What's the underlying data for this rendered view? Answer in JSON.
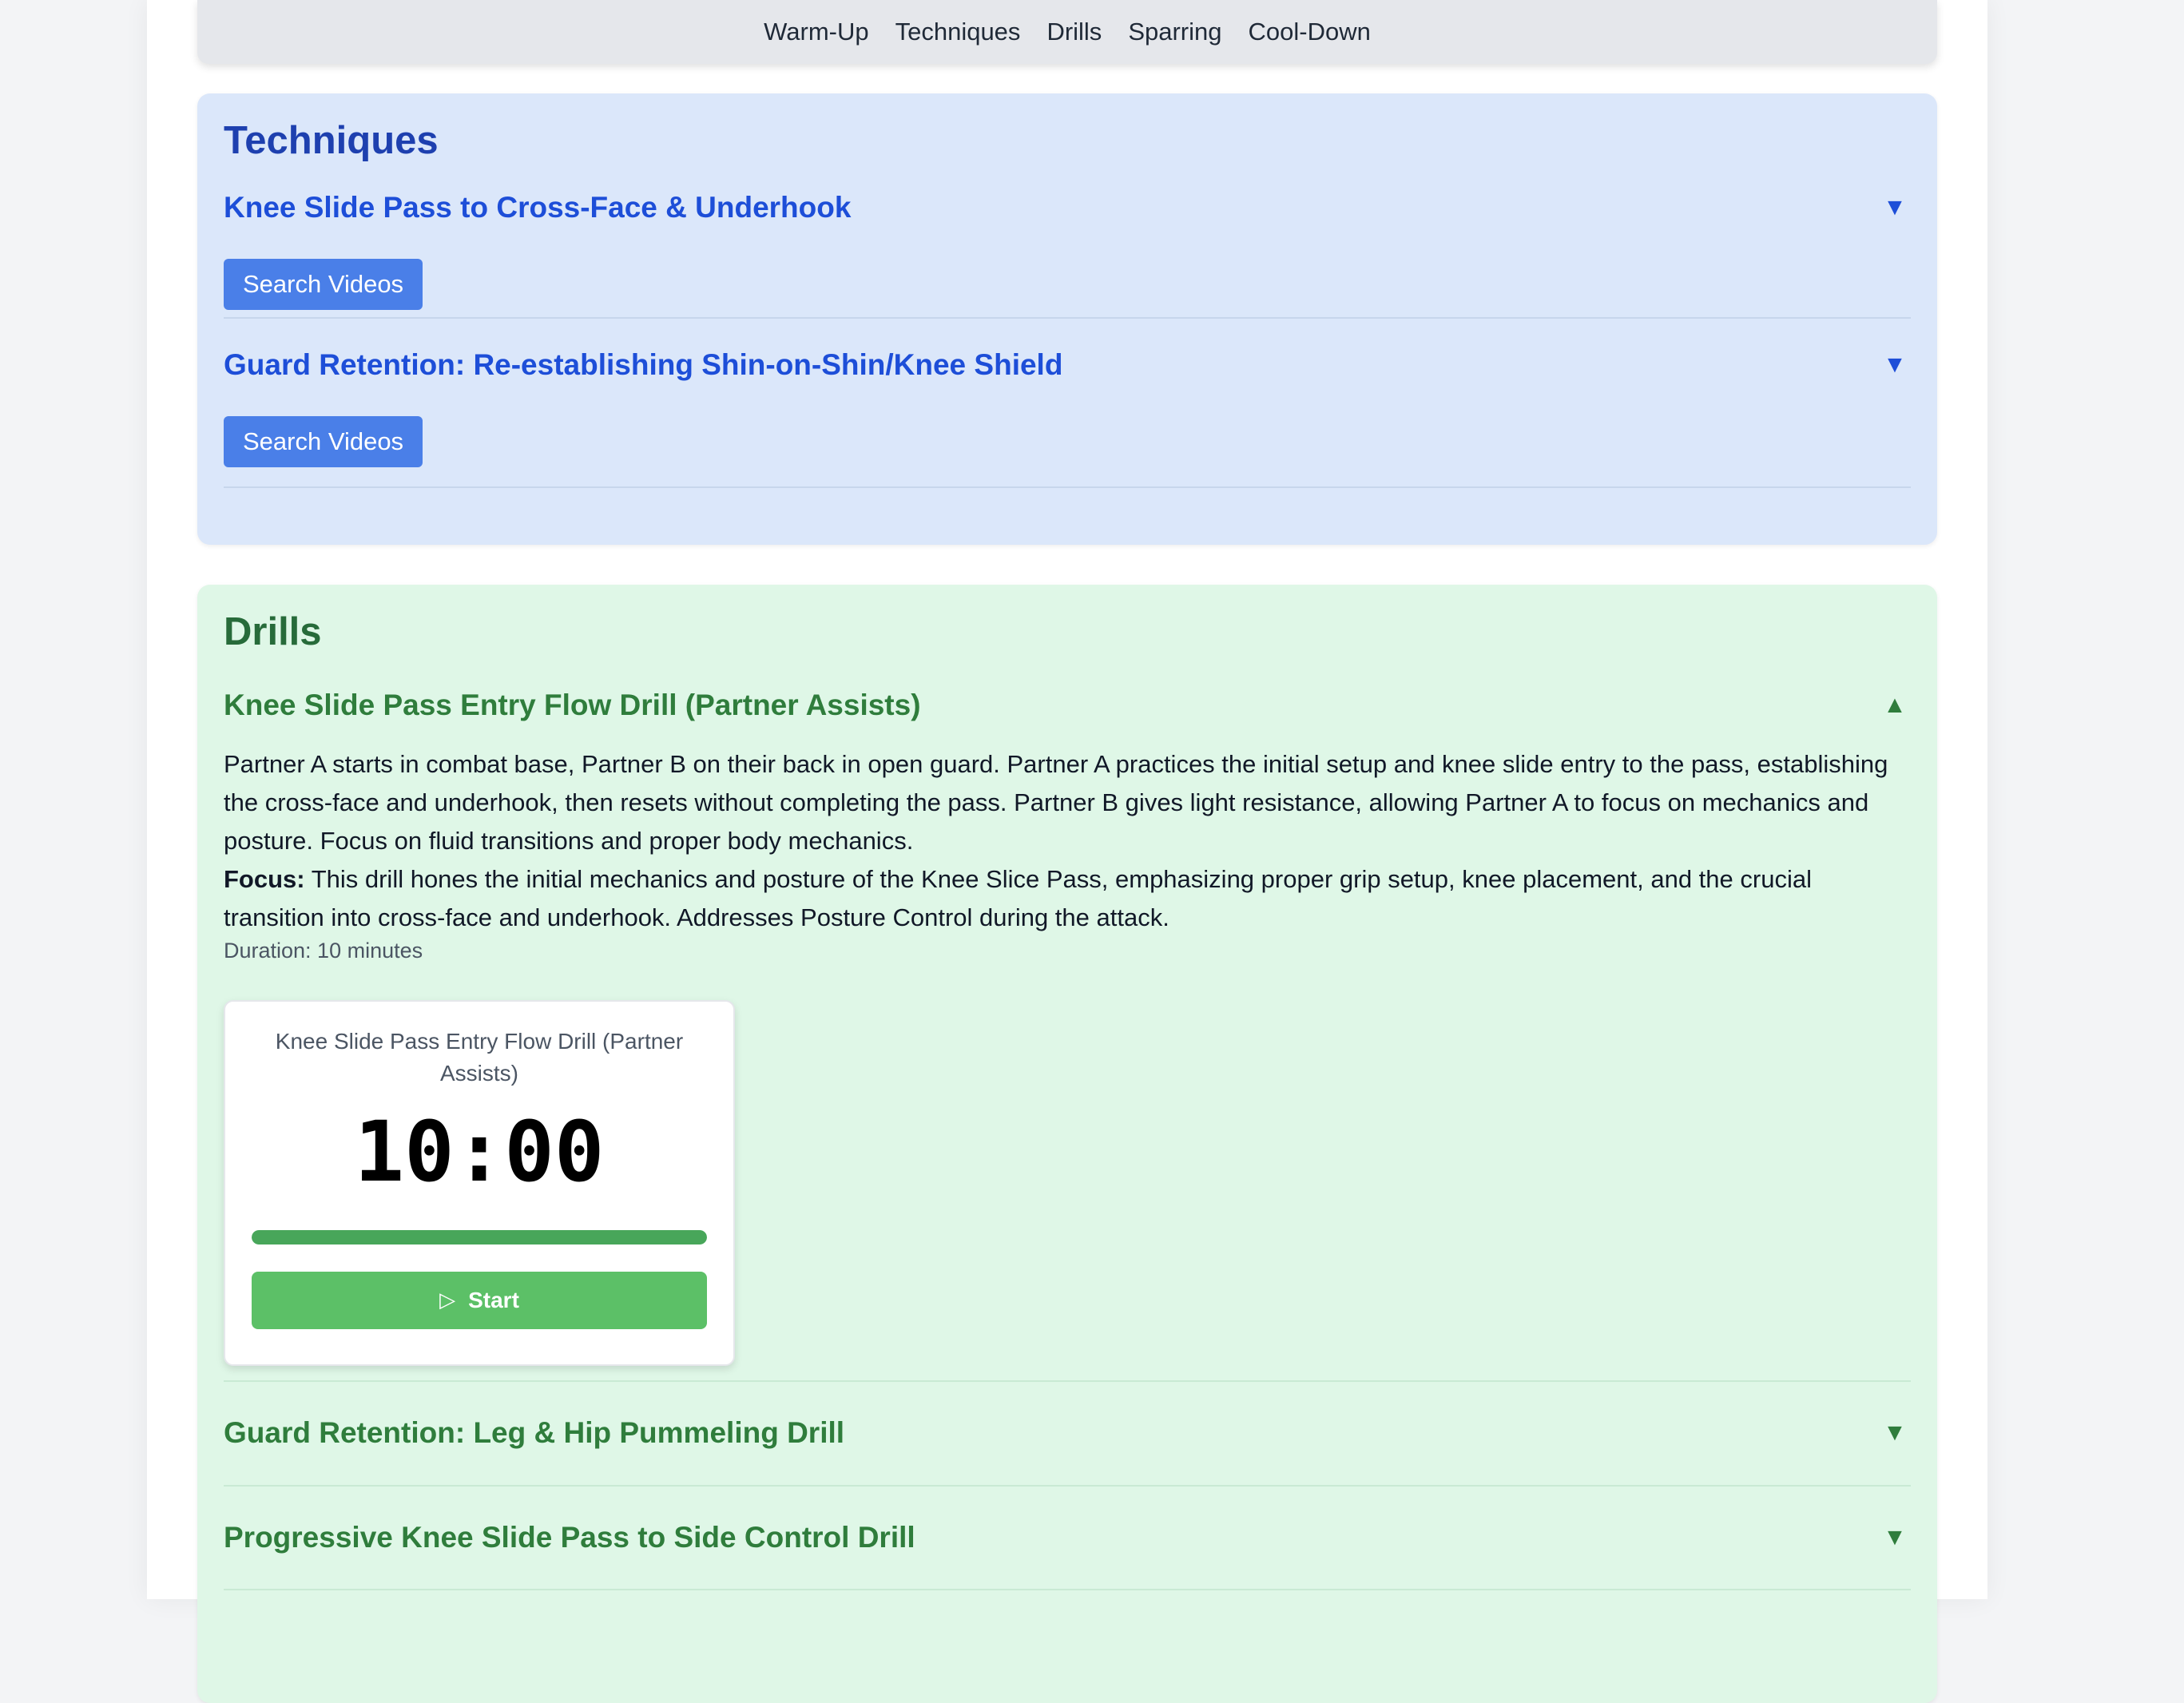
{
  "nav": {
    "items": [
      "Warm-Up",
      "Techniques",
      "Drills",
      "Sparring",
      "Cool-Down"
    ]
  },
  "techniques": {
    "title": "Techniques",
    "items": [
      {
        "title": "Knee Slide Pass to Cross-Face & Underhook",
        "button": "Search Videos",
        "chevron": "▼"
      },
      {
        "title": "Guard Retention: Re-establishing Shin-on-Shin/Knee Shield",
        "button": "Search Videos",
        "chevron": "▼"
      }
    ]
  },
  "drills": {
    "title": "Drills",
    "items": [
      {
        "title": "Knee Slide Pass Entry Flow Drill (Partner Assists)",
        "chevron": "▲",
        "description": "Partner A starts in combat base, Partner B on their back in open guard. Partner A practices the initial setup and knee slide entry to the pass, establishing the cross-face and underhook, then resets without completing the pass. Partner B gives light resistance, allowing Partner A to focus on mechanics and posture. Focus on fluid transitions and proper body mechanics.",
        "focus_label": "Focus:",
        "focus_text": "This drill hones the initial mechanics and posture of the Knee Slice Pass, emphasizing proper grip setup, knee placement, and the crucial transition into cross-face and underhook. Addresses Posture Control during the attack.",
        "duration": "Duration: 10 minutes",
        "timer": {
          "title": "Knee Slide Pass Entry Flow Drill (Partner Assists)",
          "value": "10:00",
          "progress": 1.0,
          "start_label": "Start",
          "start_icon": "play-icon"
        }
      },
      {
        "title": "Guard Retention: Leg & Hip Pummeling Drill",
        "chevron": "▼"
      },
      {
        "title": "Progressive Knee Slide Pass to Side Control Drill",
        "chevron": "▼"
      }
    ]
  },
  "colors": {
    "techniques_bg": "#dbe7fa",
    "drills_bg": "#dff7e7",
    "button_blue": "#4a7fe8",
    "start_green": "#5cc067"
  }
}
